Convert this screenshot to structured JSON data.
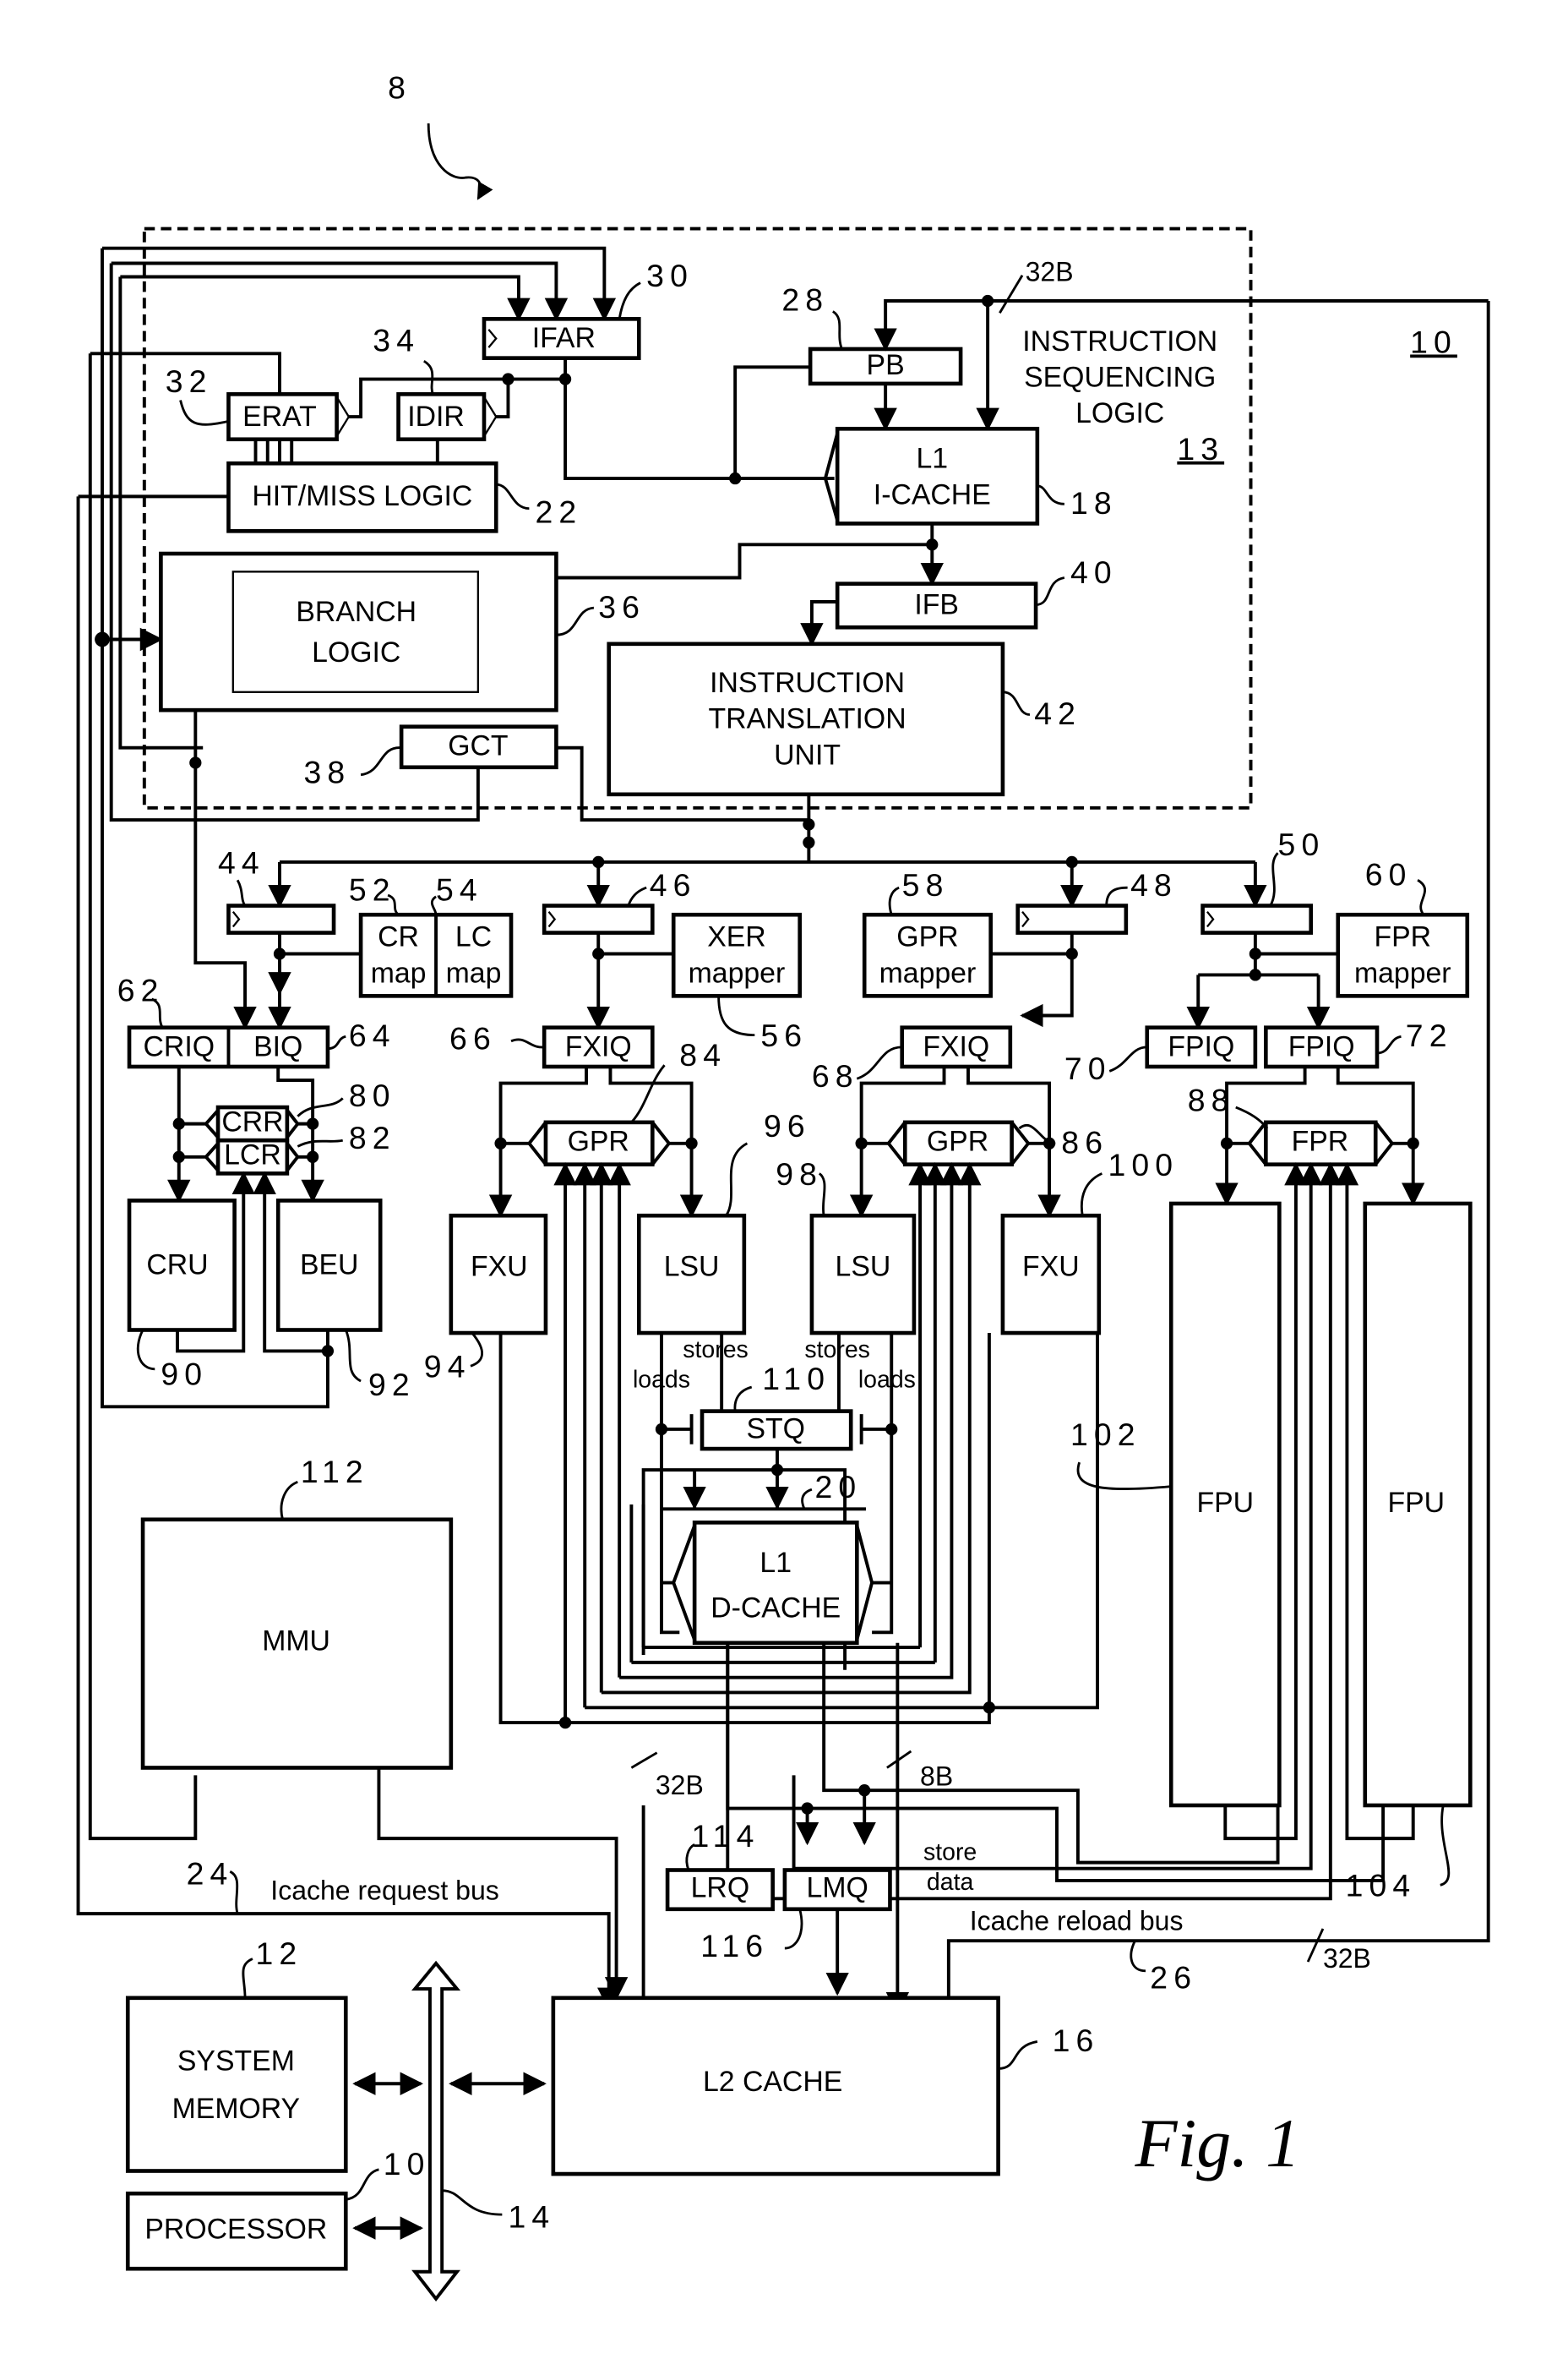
{
  "figure": {
    "caption": "Fig. 1",
    "top_ref": "8",
    "processor_ref": "10",
    "isl_ref": "13"
  },
  "blocks": {
    "ifar": "IFAR",
    "ifar_ref": "30",
    "erat": "ERAT",
    "erat_ref": "32",
    "idir": "IDIR",
    "idir_ref": "34",
    "hitmiss": "HIT/MISS LOGIC",
    "hitmiss_ref": "22",
    "pb": "PB",
    "pb_ref": "28",
    "isl_l1": "INSTRUCTION",
    "isl_l2": "SEQUENCING",
    "isl_l3": "LOGIC",
    "icache_l1": "L1",
    "icache_l2": "I-CACHE",
    "icache_ref": "18",
    "branch_l1": "BRANCH",
    "branch_l2": "LOGIC",
    "branch_ref": "36",
    "ifb": "IFB",
    "ifb_ref": "40",
    "itu_l1": "INSTRUCTION",
    "itu_l2": "TRANSLATION",
    "itu_l3": "UNIT",
    "itu_ref": "42",
    "gct": "GCT",
    "gct_ref": "38",
    "disp44_ref": "44",
    "disp46_ref": "46",
    "disp48_ref": "48",
    "disp50_ref": "50",
    "crmap_l1": "CR",
    "crmap_l2": "map",
    "crmap_ref": "52",
    "lcmap_l1": "LC",
    "lcmap_l2": "map",
    "lcmap_ref": "54",
    "xer_l1": "XER",
    "xer_l2": "mapper",
    "xer_ref": "56",
    "gprmap_l1": "GPR",
    "gprmap_l2": "mapper",
    "gprmap_ref": "58",
    "fprmap_l1": "FPR",
    "fprmap_l2": "mapper",
    "fprmap_ref": "60",
    "criq": "CRIQ",
    "criq_ref": "62",
    "biq": "BIQ",
    "biq_ref": "64",
    "fxiq1": "FXIQ",
    "fxiq1_ref": "66",
    "fxiq2": "FXIQ",
    "fxiq2_ref": "68",
    "fpiq1": "FPIQ",
    "fpiq1_ref": "70",
    "fpiq2": "FPIQ",
    "fpiq2_ref": "72",
    "crr": "CRR",
    "crr_ref": "80",
    "lcr": "LCR",
    "lcr_ref": "82",
    "gpr1": "GPR",
    "gpr1_ref": "84",
    "gpr2": "GPR",
    "gpr2_ref": "86",
    "fpr": "FPR",
    "fpr_ref": "88",
    "cru": "CRU",
    "cru_ref": "90",
    "beu": "BEU",
    "beu_ref": "92",
    "fxu1": "FXU",
    "fxu1_ref": "94",
    "lsu1": "LSU",
    "lsu1_ref": "96",
    "lsu2": "LSU",
    "lsu2_ref": "98",
    "fxu2": "FXU",
    "fxu2_ref": "100",
    "fpu1": "FPU",
    "fpu1_ref": "102",
    "fpu2": "FPU",
    "fpu2_ref": "104",
    "stq": "STQ",
    "stq_ref": "110",
    "dcache_l1": "L1",
    "dcache_l2": "D-CACHE",
    "dcache_ref": "20",
    "mmu": "MMU",
    "mmu_ref": "112",
    "lrq": "LRQ",
    "lrq_ref": "114",
    "lmq": "LMQ",
    "lmq_ref": "116",
    "l2": "L2 CACHE",
    "l2_ref": "16",
    "sysmem_l1": "SYSTEM",
    "sysmem_l2": "MEMORY",
    "sysmem_ref": "12",
    "proc": "PROCESSOR",
    "proc_ref": "10",
    "bus_ref": "14"
  },
  "signals": {
    "stores": "stores",
    "loads": "loads",
    "store_data_l1": "store",
    "store_data_l2": "data",
    "width_32b": "32B",
    "width_8b": "8B",
    "icache_request_bus": "Icache request bus",
    "icache_request_ref": "24",
    "icache_reload_bus": "Icache reload bus",
    "icache_reload_ref": "26"
  }
}
